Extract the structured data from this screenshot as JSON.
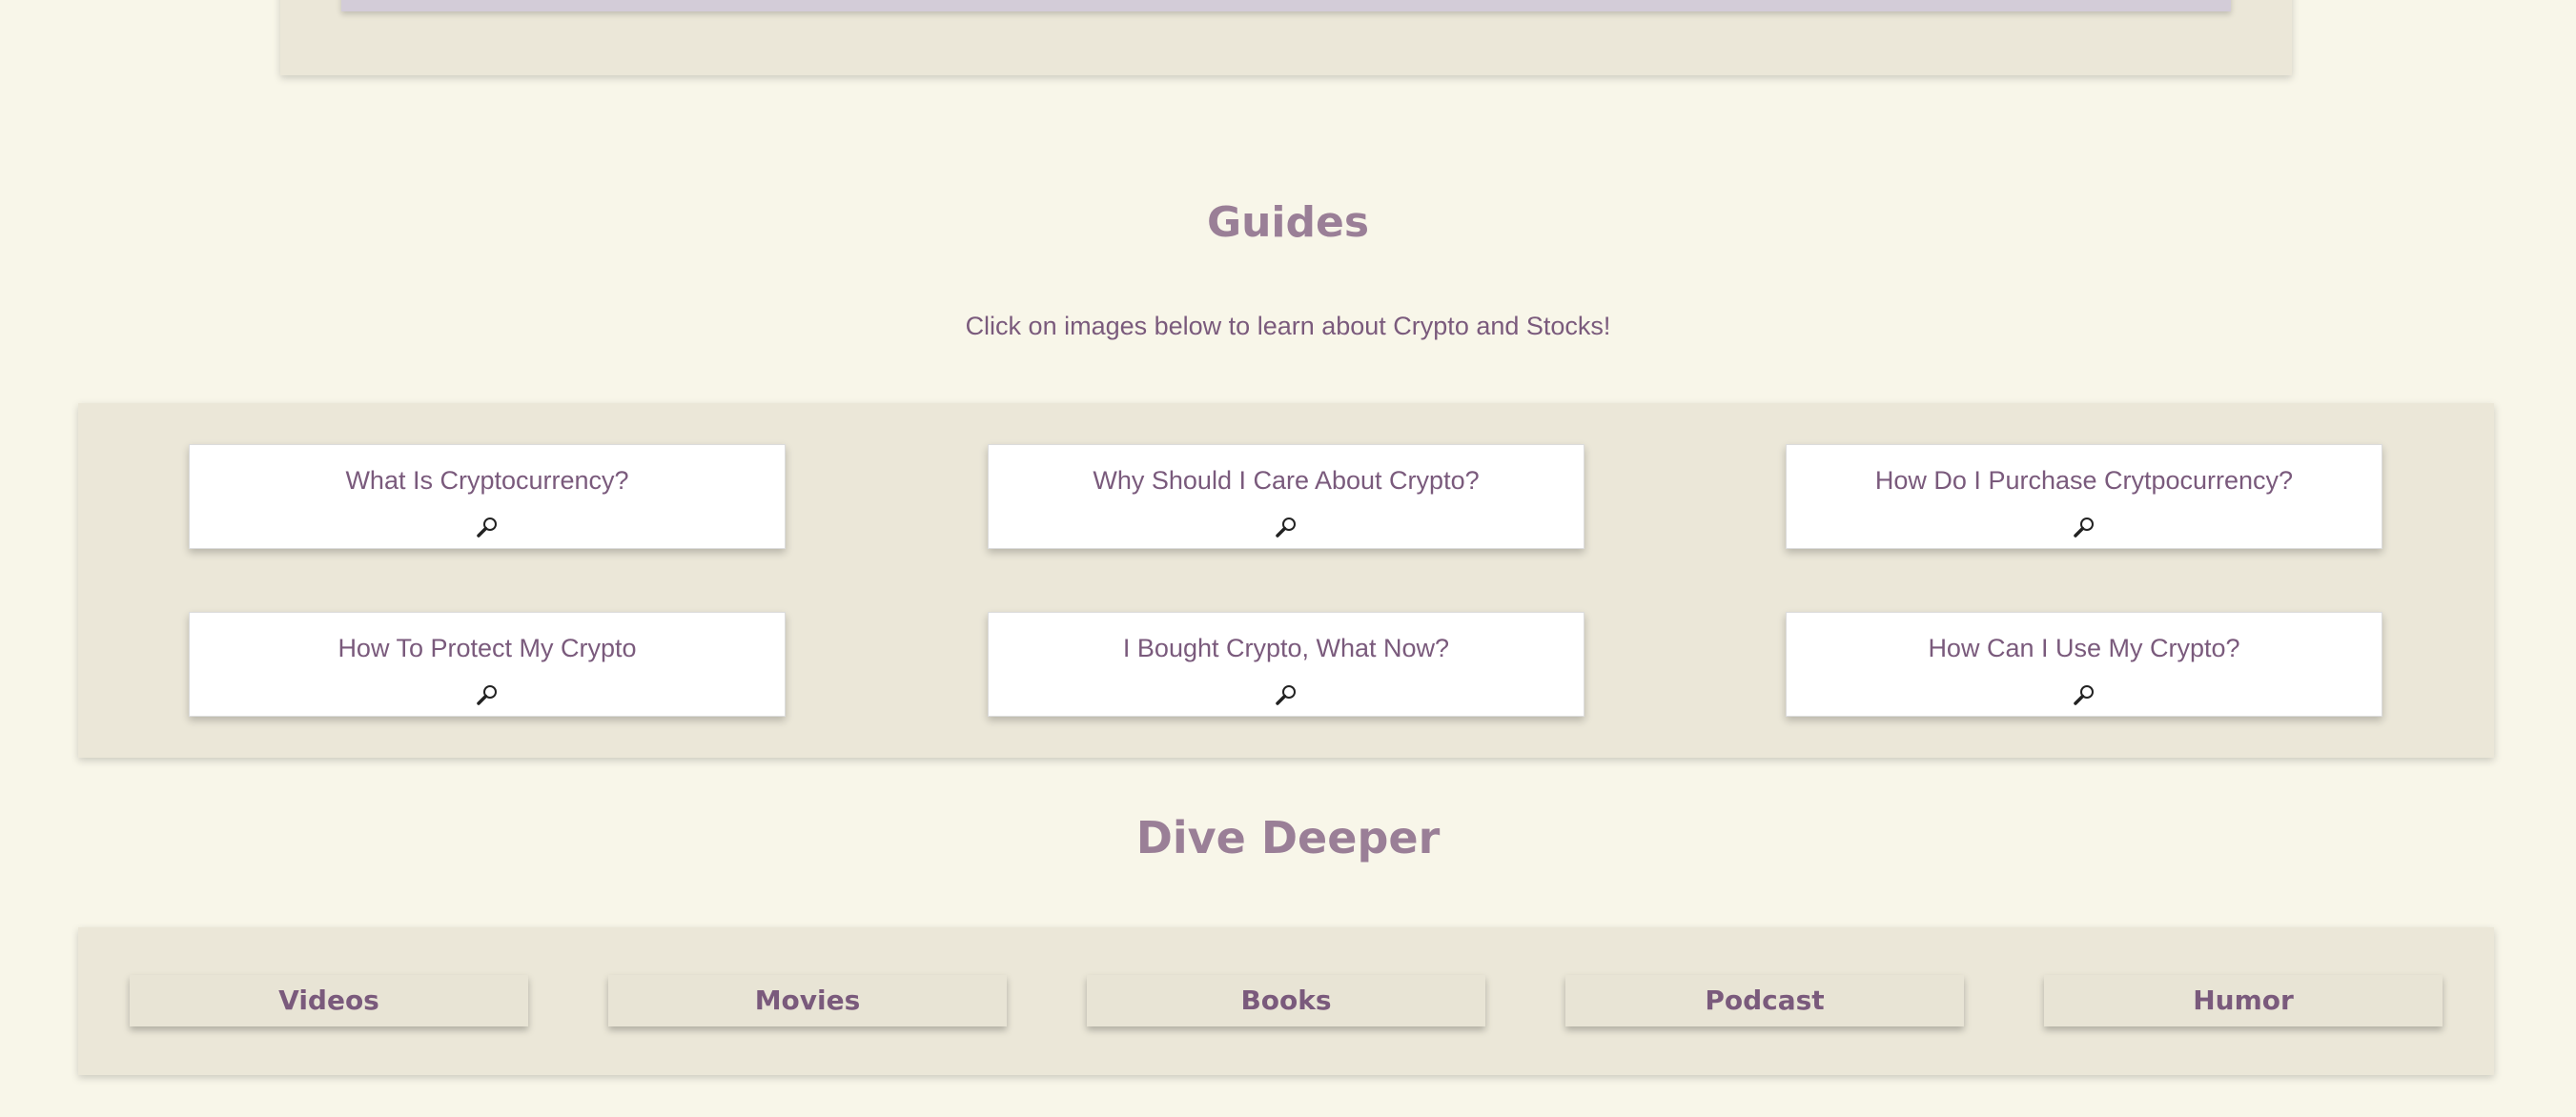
{
  "guides": {
    "title": "Guides",
    "subtitle": "Click on images below to learn about Crypto and Stocks!",
    "cards": [
      {
        "label": "What Is Cryptocurrency?",
        "icon": "magnifier-icon"
      },
      {
        "label": "Why Should I Care About Crypto?",
        "icon": "magnifier-icon"
      },
      {
        "label": "How Do I Purchase Crytpocurrency?",
        "icon": "magnifier-icon"
      },
      {
        "label": "How To Protect My Crypto",
        "icon": "magnifier-icon"
      },
      {
        "label": "I Bought Crypto, What Now?",
        "icon": "magnifier-icon"
      },
      {
        "label": "How Can I Use My Crypto?",
        "icon": "magnifier-icon"
      }
    ]
  },
  "dive_deeper": {
    "title": "Dive Deeper",
    "buttons": [
      {
        "label": "Videos"
      },
      {
        "label": "Movies"
      },
      {
        "label": "Books"
      },
      {
        "label": "Podcast"
      },
      {
        "label": "Humor"
      }
    ]
  },
  "colors": {
    "background": "#f8f6e9",
    "panel": "#ebe7d8",
    "heading": "#9a7f97",
    "text": "#7a5a7c"
  }
}
